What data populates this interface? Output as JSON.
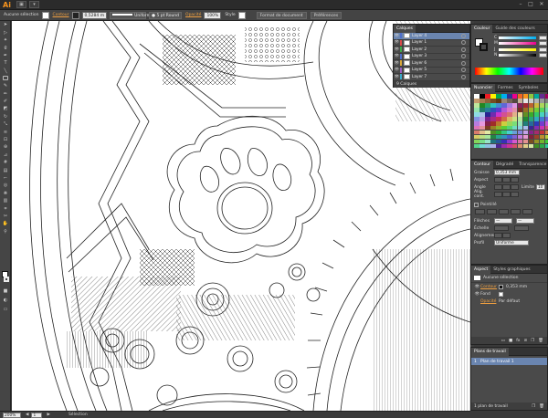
{
  "app": {
    "logo": "Ai"
  },
  "control_bar": {
    "selection": "Aucune sélection",
    "contour_label": "Contour",
    "contour_value": "0,5284 m",
    "stroke_style": "Uniforme",
    "brush": "5 pt Round",
    "opacity_label": "Opacité",
    "opacity_value": "100%",
    "style_label": "Style",
    "doc_format": "Format de document",
    "prefs": "Préférences"
  },
  "layers_panel": {
    "tab": "Calques",
    "layers": [
      {
        "name": "Layer 4",
        "color": "#4f6ec9",
        "selected": true
      },
      {
        "name": "Layer 1",
        "color": "#d94a4a",
        "selected": false
      },
      {
        "name": "Layer 2",
        "color": "#3fa84a",
        "selected": false
      },
      {
        "name": "Layer 3",
        "color": "#4f6ec9",
        "selected": false
      },
      {
        "name": "Layer 6",
        "color": "#d9a73a",
        "selected": false
      },
      {
        "name": "Layer 5",
        "color": "#9a5fc0",
        "selected": false
      },
      {
        "name": "Layer 7",
        "color": "#3aa9c9",
        "selected": false
      }
    ],
    "footer": "9 Calques"
  },
  "color_panel": {
    "tabs": [
      "Couleur",
      "Guide des couleurs"
    ],
    "sliders": [
      {
        "label": "C",
        "gradient": "linear-gradient(90deg,#fff,#00aeef)"
      },
      {
        "label": "M",
        "gradient": "linear-gradient(90deg,#fff,#ec008c)"
      },
      {
        "label": "J",
        "gradient": "linear-gradient(90deg,#fff,#fff200)"
      },
      {
        "label": "N",
        "gradient": "linear-gradient(90deg,#fff,#000)"
      }
    ]
  },
  "swatch_panel": {
    "tabs": [
      "Nuancier",
      "Formes",
      "Symboles"
    ]
  },
  "stroke_panel": {
    "tabs": [
      "Contour",
      "Dégradé",
      "Transparence"
    ],
    "graisse_label": "Graisse",
    "graisse_value": "0,353 mm",
    "aspect_label": "Aspect",
    "angle_label": "Angle",
    "limite_label": "Limite",
    "limite_value": "10",
    "alig_label": "Alig. cont.",
    "pointille": "Pointillé",
    "fleches": "Flèches",
    "echelle": "Échelle",
    "alignement": "Alignement",
    "profil_label": "Profil",
    "profil_value": "Uniforme"
  },
  "aspect_panel": {
    "tabs": [
      "Aspect",
      "Styles graphiques"
    ],
    "none_sel": "Aucune sélection",
    "contour_label": "Contour",
    "contour_value": "0,353 mm",
    "fond_label": "Fond",
    "opacity_label": "Opacité",
    "opacity_value": "Par défaut"
  },
  "artboards_panel": {
    "tab": "Plans de travail",
    "row_num": "1",
    "row_name": "Plan de travail 1",
    "footer": "1 plan de travail"
  },
  "status_bar": {
    "zoom": "200%",
    "page": "1",
    "mode": "Sélection"
  }
}
